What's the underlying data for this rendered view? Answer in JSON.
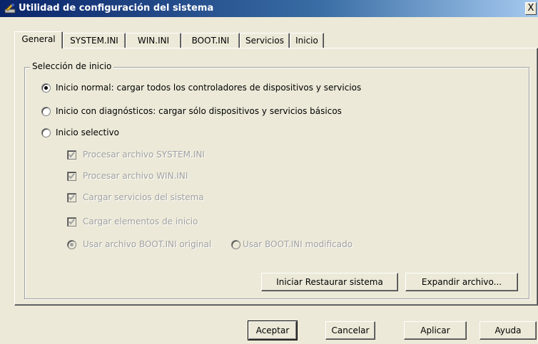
{
  "window": {
    "title": "Utilidad de configuración del sistema",
    "close_glyph": "X"
  },
  "tabs": [
    "General",
    "SYSTEM.INI",
    "WIN.INI",
    "BOOT.INI",
    "Servicios",
    "Inicio"
  ],
  "group": {
    "label": "Selección de inicio"
  },
  "startup": {
    "normal": "Inicio normal: cargar todos los controladores de dispositivos y servicios",
    "diagnostic": "Inicio con diagnósticos: cargar sólo dispositivos y servicios básicos",
    "selective": "Inicio selectivo",
    "selected": "normal"
  },
  "selective_options": {
    "system_ini": "Procesar archivo SYSTEM.INI",
    "win_ini": "Procesar archivo WIN.INI",
    "services": "Cargar servicios del sistema",
    "startup_items": "Cargar elementos de inicio",
    "boot_original": "Usar archivo BOOT.INI original",
    "boot_modified": "Usar BOOT.INI modificado"
  },
  "buttons": {
    "restore": "Iniciar Restaurar sistema",
    "expand": "Expandir archivo...",
    "ok": "Aceptar",
    "cancel": "Cancelar",
    "apply": "Aplicar",
    "help": "Ayuda"
  },
  "colors": {
    "title_start": "#0a246a",
    "title_end": "#a6caf0",
    "face": "#ece9d8",
    "disabled_text": "#a0a0a0"
  }
}
